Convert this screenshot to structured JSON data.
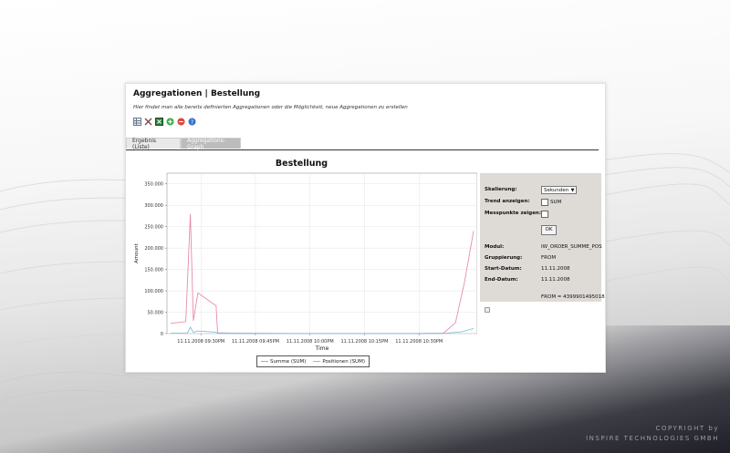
{
  "copyright": {
    "line1": "COPYRIGHT by",
    "line2": "INSPIRE TECHNOLOGIES GMBH"
  },
  "header": {
    "title": "Aggregationen | Bestellung",
    "subtitle": "Hier findet man alle bereits definierten Aggregationen oder die Möglichkeit, neue Aggregationen zu erstellen"
  },
  "toolbar": {
    "icons": [
      "table-icon",
      "tools-icon",
      "excel-icon",
      "add-icon",
      "remove-icon",
      "help-icon"
    ]
  },
  "tabs": [
    {
      "label": "Ergebnis (Liste)",
      "active": false
    },
    {
      "label": "Aggregations-Graph",
      "active": true
    }
  ],
  "chart_data": {
    "type": "line",
    "title": "Bestellung",
    "xlabel": "Time",
    "ylabel": "Amount",
    "ylim": [
      0,
      375000
    ],
    "yticks": [
      "0",
      "50.000",
      "100.000",
      "150.000",
      "200.000",
      "250.000",
      "300.000",
      "350.000"
    ],
    "xticks": [
      "11.11.2008 09:30PM",
      "11.11.2008 09:45PM",
      "11.11.2008 10:00PM",
      "11.11.2008 10:15PM",
      "11.11.2008 10:30PM"
    ],
    "grid": true,
    "legend_position": "bottom",
    "series": [
      {
        "name": "Summe (SUM)",
        "color": "#e68bb0",
        "points": [
          [
            0.0,
            24000
          ],
          [
            0.05,
            28000
          ],
          [
            0.065,
            280000
          ],
          [
            0.075,
            30000
          ],
          [
            0.09,
            95000
          ],
          [
            0.15,
            65000
          ],
          [
            0.155,
            2000
          ],
          [
            0.2,
            1000
          ],
          [
            0.4,
            500
          ],
          [
            0.6,
            500
          ],
          [
            0.8,
            500
          ],
          [
            0.9,
            1000
          ],
          [
            0.94,
            25000
          ],
          [
            0.97,
            120000
          ],
          [
            1.0,
            240000
          ]
        ]
      },
      {
        "name": "Positionen (SUM)",
        "color": "#7fc3df",
        "points": [
          [
            0.0,
            800
          ],
          [
            0.055,
            900
          ],
          [
            0.065,
            15000
          ],
          [
            0.075,
            3000
          ],
          [
            0.09,
            6000
          ],
          [
            0.15,
            3500
          ],
          [
            0.155,
            400
          ],
          [
            0.3,
            300
          ],
          [
            0.6,
            300
          ],
          [
            0.9,
            400
          ],
          [
            0.96,
            4000
          ],
          [
            1.0,
            12000
          ]
        ]
      }
    ]
  },
  "side": {
    "skalierung_label": "Skalierung:",
    "skalierung_value": "Sekunden",
    "trend_label": "Trend anzeigen:",
    "trend_value": "SUM",
    "messpunkte_label": "Messpunkte zeigen:",
    "ok_label": "OK",
    "modul_label": "Modul:",
    "modul_value": "IW_ORDER_SUMME_POS",
    "gruppierung_label": "Gruppierung:",
    "gruppierung_value": "FROM",
    "start_label": "Start-Datum:",
    "start_value": "11.11.2008",
    "end_label": "End-Datum:",
    "end_value": "11.11.2008",
    "from_text": "FROM = 4399901495018"
  }
}
